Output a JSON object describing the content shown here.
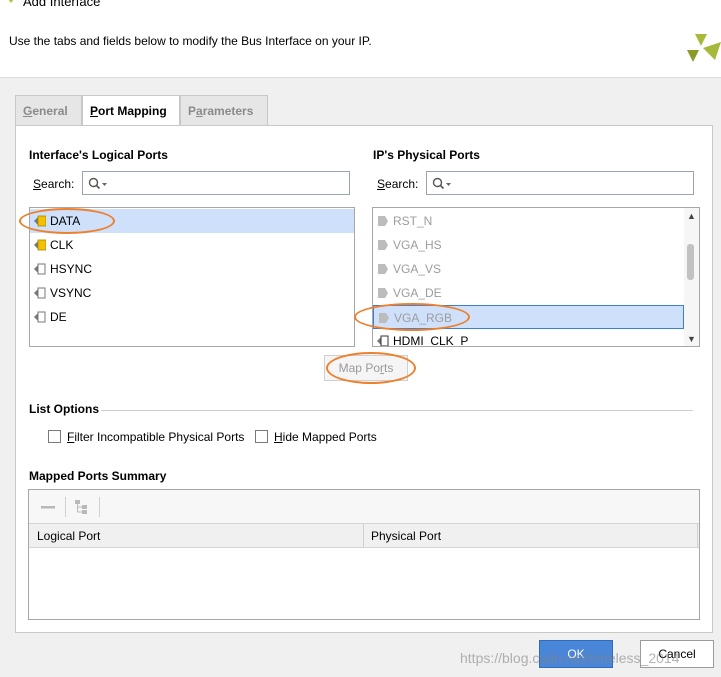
{
  "window": {
    "title": "Add Interface",
    "description": "Use the tabs and fields below to modify the Bus Interface on your IP."
  },
  "tabs": [
    {
      "label": "General",
      "mnemonic": "G",
      "rest": "eneral",
      "active": false
    },
    {
      "label": "Port Mapping",
      "mnemonic": "P",
      "rest": "ort Mapping",
      "active": true
    },
    {
      "label": "Parameters",
      "mnemonic": "a",
      "prefix": "P",
      "rest": "rameters",
      "active": false
    }
  ],
  "logical": {
    "heading": "Interface's Logical Ports",
    "search_label_mn": "S",
    "search_label_rest": "earch:",
    "ports": [
      "DATA",
      "CLK",
      "HSYNC",
      "VSYNC",
      "DE"
    ]
  },
  "physical": {
    "heading": "IP's Physical Ports",
    "search_label_mn": "S",
    "search_label_rest": "earch:",
    "ports": [
      "RST_N",
      "VGA_HS",
      "VGA_VS",
      "VGA_DE",
      "VGA_RGB",
      "HDMI_CLK_P"
    ]
  },
  "map_ports": {
    "prefix": "Map Po",
    "mn": "r",
    "rest": "ts"
  },
  "list_options": {
    "heading": "List Options",
    "filter_label_mn": "F",
    "filter_label_rest": "ilter Incompatible Physical Ports",
    "hide_label_mn": "H",
    "hide_label_rest": "ide Mapped Ports"
  },
  "summary": {
    "heading": "Mapped Ports Summary",
    "columns": [
      "Logical Port",
      "Physical Port"
    ]
  },
  "footer": {
    "ok": "OK",
    "cancel": "Cancel",
    "watermark": "https://blog.csdn.net/timeless_2014"
  },
  "colors": {
    "accent": "#4a86d8",
    "selection": "#cfe0fa",
    "highlight_ring": "#ee7f2d",
    "logo_green": "#a8b83a"
  }
}
